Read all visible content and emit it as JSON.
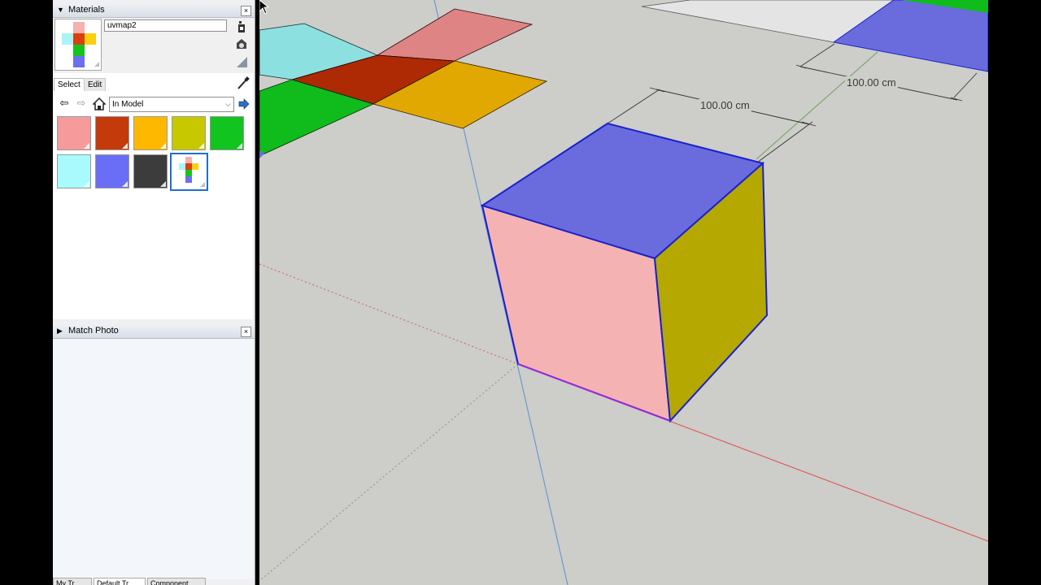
{
  "materials_panel": {
    "title": "Materials",
    "close_glyph": "×",
    "material_name": "uvmap2",
    "tabs": [
      {
        "label": "Select",
        "active": true
      },
      {
        "label": "Edit",
        "active": false
      }
    ],
    "icons": {
      "create_material": "create-material-icon",
      "display_secondary": "display-secondary-icon",
      "default_material": "default-material-icon",
      "sample_paint": "sample-paint-icon",
      "back": "back-arrow-icon",
      "forward": "forward-arrow-icon",
      "home": "home-icon",
      "details": "details-arrow-icon"
    },
    "collection": "In Model",
    "swatches": [
      {
        "name": "pink",
        "color": "#f59b9b"
      },
      {
        "name": "red-orange",
        "color": "#c53a0a"
      },
      {
        "name": "orange-yellow",
        "color": "#ffb800"
      },
      {
        "name": "olive-yellow",
        "color": "#c8c800"
      },
      {
        "name": "green",
        "color": "#11c41e"
      },
      {
        "name": "light-cyan",
        "color": "#a8fafd"
      },
      {
        "name": "blue-violet",
        "color": "#6a6ef6"
      },
      {
        "name": "dark-gray",
        "color": "#3c3c3c"
      },
      {
        "name": "uvmap2",
        "color": "texture",
        "selected": true
      }
    ]
  },
  "match_photo_panel": {
    "title": "Match Photo",
    "close_glyph": "×"
  },
  "bottom_tabs": [
    "My Tr",
    "Default Tr",
    "Component"
  ],
  "viewport": {
    "dimension_labels": [
      "100.00 cm",
      "100.00 cm"
    ],
    "colors": {
      "background": "#cdcdc9",
      "top_face": "#6a6cde",
      "front_face": "#f5b2b2",
      "side_face": "#b5a800",
      "edge": "#1a22c8",
      "tile_cyan": "#8de0e0",
      "tile_red": "#ad2a04",
      "tile_pink": "#de8484",
      "tile_orange": "#e1a802",
      "tile_green": "#0fbc1c",
      "white_face": "#e4e4e4"
    }
  }
}
